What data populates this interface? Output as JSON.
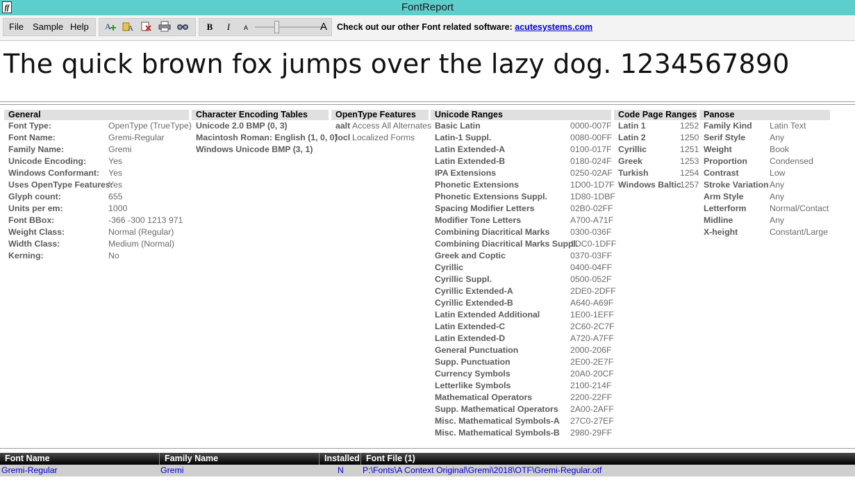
{
  "window": {
    "title": "FontReport",
    "icon_glyph": "ff"
  },
  "menu": [
    "File",
    "Sample",
    "Help"
  ],
  "toolbar": {
    "bold_label": "B",
    "italic_label": "I",
    "slider_small_label": "A",
    "slider_large_label": "A",
    "promo_text": "Check out our other Font related software: ",
    "promo_link": "acutesystems.com"
  },
  "sample_text": "The quick brown fox jumps over the lazy dog. 1234567890",
  "general": {
    "title": "General",
    "rows": [
      {
        "k": "Font Type:",
        "v": "OpenType (TrueType)"
      },
      {
        "k": "Font Name:",
        "v": "Gremi-Regular"
      },
      {
        "k": "Family Name:",
        "v": "Gremi"
      },
      {
        "k": "Unicode Encoding:",
        "v": "Yes"
      },
      {
        "k": "Windows Conformant:",
        "v": "Yes"
      },
      {
        "k": "Uses OpenType Features:",
        "v": "Yes"
      },
      {
        "k": "Glyph count:",
        "v": "655"
      },
      {
        "k": "Units per em:",
        "v": "1000"
      },
      {
        "k": "Font BBox:",
        "v": "-366 -300 1213 971"
      },
      {
        "k": "Weight Class:",
        "v": "Normal (Regular)"
      },
      {
        "k": "Width Class:",
        "v": "Medium (Normal)"
      },
      {
        "k": "Kerning:",
        "v": "No"
      }
    ]
  },
  "encoding": {
    "title": "Character Encoding Tables",
    "rows": [
      "Unicode 2.0 BMP (0, 3)",
      "Macintosh Roman: English (1, 0, 0)",
      "Windows Unicode BMP (3, 1)"
    ]
  },
  "opentype": {
    "title": "OpenType Features",
    "rows": [
      {
        "k": "aalt",
        "v": "Access All Alternates"
      },
      {
        "k": "locl",
        "v": "Localized Forms"
      }
    ]
  },
  "unicode": {
    "title": "Unicode Ranges",
    "rows": [
      {
        "k": "Basic Latin",
        "v": "0000-007F"
      },
      {
        "k": "Latin-1 Suppl.",
        "v": "0080-00FF"
      },
      {
        "k": "Latin Extended-A",
        "v": "0100-017F"
      },
      {
        "k": "Latin Extended-B",
        "v": "0180-024F"
      },
      {
        "k": "IPA Extensions",
        "v": "0250-02AF"
      },
      {
        "k": "Phonetic Extensions",
        "v": "1D00-1D7F"
      },
      {
        "k": "Phonetic Extensions Suppl.",
        "v": "1D80-1DBF"
      },
      {
        "k": "Spacing Modifier Letters",
        "v": "02B0-02FF"
      },
      {
        "k": "Modifier Tone Letters",
        "v": "A700-A71F"
      },
      {
        "k": "Combining Diacritical Marks",
        "v": "0300-036F"
      },
      {
        "k": "Combining Diacritical Marks Suppl.",
        "v": "1DC0-1DFF"
      },
      {
        "k": "Greek and Coptic",
        "v": "0370-03FF"
      },
      {
        "k": "Cyrillic",
        "v": "0400-04FF"
      },
      {
        "k": "Cyrillic Suppl.",
        "v": "0500-052F"
      },
      {
        "k": "Cyrillic Extended-A",
        "v": "2DE0-2DFF"
      },
      {
        "k": "Cyrillic Extended-B",
        "v": "A640-A69F"
      },
      {
        "k": "Latin Extended Additional",
        "v": "1E00-1EFF"
      },
      {
        "k": "Latin Extended-C",
        "v": "2C60-2C7F"
      },
      {
        "k": "Latin Extended-D",
        "v": "A720-A7FF"
      },
      {
        "k": "General Punctuation",
        "v": "2000-206F"
      },
      {
        "k": "Supp. Punctuation",
        "v": "2E00-2E7F"
      },
      {
        "k": "Currency Symbols",
        "v": "20A0-20CF"
      },
      {
        "k": "Letterlike Symbols",
        "v": "2100-214F"
      },
      {
        "k": "Mathematical Operators",
        "v": "2200-22FF"
      },
      {
        "k": "Supp. Mathematical Operators",
        "v": "2A00-2AFF"
      },
      {
        "k": "Misc. Mathematical Symbols-A",
        "v": "27C0-27EF"
      },
      {
        "k": "Misc. Mathematical Symbols-B",
        "v": "2980-29FF"
      }
    ]
  },
  "codepage": {
    "title": "Code Page Ranges",
    "rows": [
      {
        "k": "Latin 1",
        "v": "1252"
      },
      {
        "k": "Latin 2",
        "v": "1250"
      },
      {
        "k": "Cyrillic",
        "v": "1251"
      },
      {
        "k": "Greek",
        "v": "1253"
      },
      {
        "k": "Turkish",
        "v": "1254"
      },
      {
        "k": "Windows Baltic",
        "v": "1257"
      }
    ]
  },
  "panose": {
    "title": "Panose",
    "rows": [
      {
        "k": "Family Kind",
        "v": "Latin Text"
      },
      {
        "k": "Serif Style",
        "v": "Any"
      },
      {
        "k": "Weight",
        "v": "Book"
      },
      {
        "k": "Proportion",
        "v": "Condensed"
      },
      {
        "k": "Contrast",
        "v": "Low"
      },
      {
        "k": "Stroke Variation",
        "v": "Any"
      },
      {
        "k": "Arm Style",
        "v": "Any"
      },
      {
        "k": "Letterform",
        "v": "Normal/Contact"
      },
      {
        "k": "Midline",
        "v": "Any"
      },
      {
        "k": "X-height",
        "v": "Constant/Large"
      }
    ]
  },
  "font_list": {
    "headers": [
      "Font Name",
      "Family Name",
      "Installed",
      "Font File (1)"
    ],
    "rows": [
      [
        "Gremi-Regular",
        "Gremi",
        "N",
        "P:\\Fonts\\A Context Original\\Gremi\\2018\\OTF\\Gremi-Regular.otf"
      ]
    ]
  },
  "colors": {
    "titlebar": "#5ccfcc",
    "link": "#0000cc",
    "header_bg": "#e0e0e0"
  }
}
